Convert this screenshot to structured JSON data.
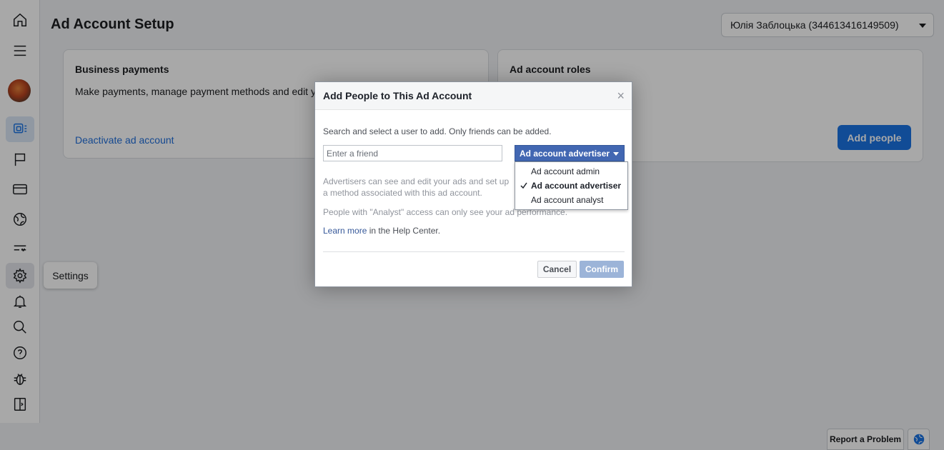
{
  "page": {
    "title": "Ad Account Setup"
  },
  "account_selector": {
    "label": "Юлія Заблоцька (344613416149509)"
  },
  "sidebar": {
    "items": [
      {
        "name": "home-icon"
      },
      {
        "name": "menu-icon"
      },
      {
        "name": "avatar"
      },
      {
        "name": "ads-manager-icon",
        "active": true
      },
      {
        "name": "flag-icon"
      },
      {
        "name": "credit-card-icon"
      },
      {
        "name": "globe-icon"
      },
      {
        "name": "tools-icon"
      },
      {
        "name": "gear-icon"
      },
      {
        "name": "bell-icon"
      },
      {
        "name": "search-icon"
      },
      {
        "name": "help-icon"
      },
      {
        "name": "bug-icon"
      },
      {
        "name": "panel-icon"
      }
    ],
    "tooltip": "Settings"
  },
  "cards": {
    "payments": {
      "title": "Business payments",
      "description": "Make payments, manage payment methods and edit y",
      "link": "Deactivate ad account"
    },
    "roles": {
      "title": "Ad account roles",
      "button": "Add people"
    }
  },
  "dialog": {
    "title": "Add People to This Ad Account",
    "close": "×",
    "intro": "Search and select a user to add. Only friends can be added.",
    "friend_placeholder": "Enter a friend",
    "role_selected": "Ad account advertiser",
    "role_options": [
      "Ad account admin",
      "Ad account advertiser",
      "Ad account analyst"
    ],
    "advertiser_text": "Advertisers can see and edit your ads and set up a method associated with this ad account.",
    "analyst_text": "People with \"Analyst\" access can only see your ad performance.",
    "learn_more": "Learn more",
    "help_suffix": " in the Help Center.",
    "cancel": "Cancel",
    "confirm": "Confirm"
  },
  "footer": {
    "report": "Report a Problem"
  },
  "colors": {
    "accent": "#1b74e4",
    "dialog_button": "#4267b2",
    "confirm_disabled": "#9cb4d8"
  }
}
